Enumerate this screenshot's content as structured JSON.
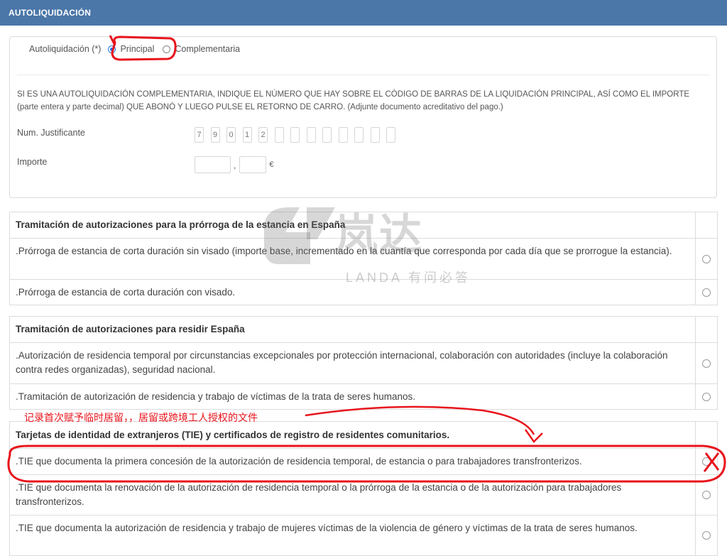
{
  "header": {
    "title": "AUTOLIQUIDACIÓN"
  },
  "autoliquidacion": {
    "label": "Autoliquidación (*)",
    "options": [
      {
        "label": "Principal",
        "checked": true
      },
      {
        "label": "Complementaria",
        "checked": false
      }
    ],
    "instructions": "SI ES UNA AUTOLIQUIDACIÓN COMPLEMENTARIA, INDIQUE EL NÚMERO QUE HAY SOBRE EL CÓDIGO DE BARRAS DE LA LIQUIDACIÓN PRINCIPAL, ASÍ COMO EL IMPORTE (parte entera y parte decimal) QUE ABONÓ Y LUEGO PULSE EL RETORNO DE CARRO. (Adjunte documento acreditativo del pago.)",
    "num_label": "Num. Justificante",
    "digits": [
      "7",
      "9",
      "0",
      "1",
      "2",
      "",
      "",
      "",
      "",
      "",
      "",
      "",
      ""
    ],
    "importe_label": "Importe",
    "decimal_sep": ",",
    "currency": "€"
  },
  "sections": [
    {
      "title": "Tramitación de autorizaciones para la prórroga de la estancia en España",
      "items": [
        ".Prórroga de estancia de corta duración sin visado (importe base, incrementado en la cuantía que corresponda por cada día que se prorrogue la estancia).",
        ".Prórroga de estancia de corta duración con visado."
      ]
    },
    {
      "title": "Tramitación de autorizaciones para residir España",
      "items": [
        ".Autorización de residencia temporal por circunstancias excepcionales por protección internacional, colaboración con autoridades (incluye la colaboración contra redes organizadas), seguridad nacional.",
        ".Tramitación de autorización de residencia y trabajo de víctimas de la trata de seres humanos."
      ]
    },
    {
      "title": "Tarjetas de identidad de extranjeros (TIE) y certificados de registro de residentes comunitarios.",
      "items": [
        ".TIE que documenta la primera concesión de la autorización de residencia temporal, de estancia o para trabajadores transfronterizos.",
        ".TIE que documenta la renovación de la autorización de residencia temporal o la prórroga de la estancia o de la autorización para trabajadores transfronterizos.",
        ".TIE que documenta la autorización de residencia y trabajo de mujeres víctimas de la violencia de género y víctimas de la trata de seres humanos."
      ]
    }
  ],
  "annotation": {
    "note": "记录首次赋予临时居留，，居留或跨境工人授权的文件"
  },
  "watermark": {
    "brand": "岚达",
    "sub": "LANDA 有问必答"
  },
  "colors": {
    "header": "#4a76a8",
    "annotation": "#e8141c",
    "radio_checked": "#1a73e8"
  }
}
